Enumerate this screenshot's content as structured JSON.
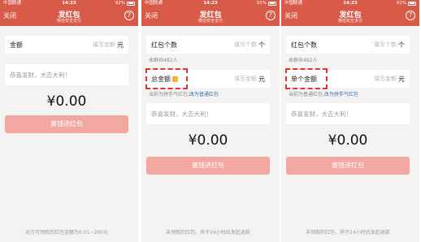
{
  "status": {
    "carrier": "中国联通",
    "time": "14:23",
    "battery_1": "92%",
    "battery_2": "91%",
    "battery_3": "91%"
  },
  "nav": {
    "close": "关闭",
    "title": "发红包",
    "subtitle": "微信安全支付",
    "help": "?"
  },
  "panel1": {
    "amount_label": "金额",
    "amount_placeholder": "填写金额",
    "unit": "元",
    "greeting": "恭喜发财，大吉大利！",
    "amount_display": "¥0.00",
    "send_button": "塞钱进红包",
    "footer": "对方可领取的红包金额为0.01~200元"
  },
  "panel2": {
    "count_label": "红包个数",
    "count_placeholder": "填写个数",
    "count_unit": "个",
    "group_note": "本群共482人",
    "total_label": "总金额",
    "amount_placeholder": "填写金额",
    "unit": "元",
    "mode_note": "当前为拼手气红包,",
    "mode_link": "改为普通红包",
    "greeting": "恭喜发财，大吉大利！",
    "amount_display": "¥0.00",
    "send_button": "塞钱进红包",
    "footer": "未领取的红包，将于24小时后发起退款"
  },
  "panel3": {
    "count_label": "红包个数",
    "count_placeholder": "填写个数",
    "count_unit": "个",
    "group_note": "本群共482人",
    "single_label": "单个金额",
    "amount_placeholder": "填写金额",
    "unit": "元",
    "mode_note": "当前为普通红包,",
    "mode_link": "改为拼手气红包",
    "greeting": "恭喜发财，大吉大利！",
    "amount_display": "¥0.00",
    "send_button": "塞钱进红包",
    "footer": "未领取的红包，将于24小时后发起退款"
  },
  "colors": {
    "header": "#d85a48",
    "button": "#f2a7a0",
    "highlight": "#e2322d",
    "link": "#3a6fb0"
  }
}
